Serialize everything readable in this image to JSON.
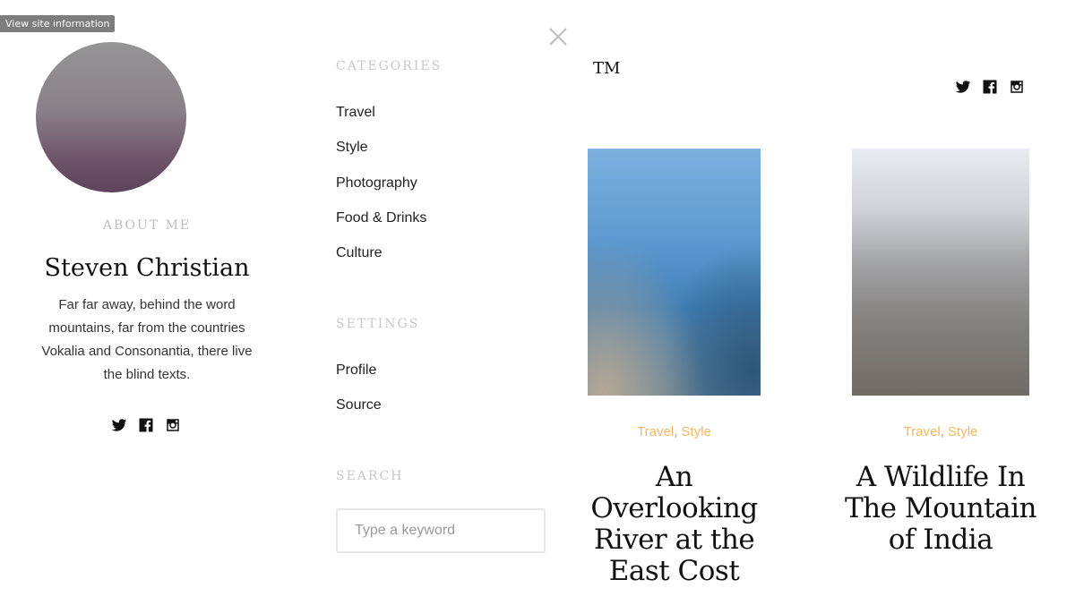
{
  "tooltip": {
    "text": "View site information"
  },
  "about": {
    "heading": "ABOUT ME",
    "name": "Steven Christian",
    "bio": "Far far away, behind the word mountains, far from the countries Vokalia and Consonantia, there live the blind texts.",
    "social": [
      "twitter-icon",
      "facebook-icon",
      "instagram-icon"
    ]
  },
  "menu": {
    "categories_heading": "CATEGORIES",
    "categories": [
      "Travel",
      "Style",
      "Photography",
      "Food & Drinks",
      "Culture"
    ],
    "settings_heading": "SETTINGS",
    "settings": [
      "Profile",
      "Source"
    ],
    "search_heading": "SEARCH",
    "search_placeholder": "Type a keyword",
    "search_value": ""
  },
  "header": {
    "logo": "TM",
    "close_icon": "close-icon",
    "social": [
      "twitter-icon",
      "facebook-icon",
      "instagram-icon"
    ]
  },
  "posts": [
    {
      "categories": [
        "Travel",
        "Style"
      ],
      "separator": ", ",
      "title": "An Overlooking River at the East Cost"
    },
    {
      "categories": [
        "Travel",
        "Style"
      ],
      "separator": ", ",
      "title": "A Wildlife In The Mountain of India"
    }
  ],
  "colors": {
    "accent": "#f2b860",
    "muted_heading": "#c8c8c8",
    "text": "#222222"
  }
}
